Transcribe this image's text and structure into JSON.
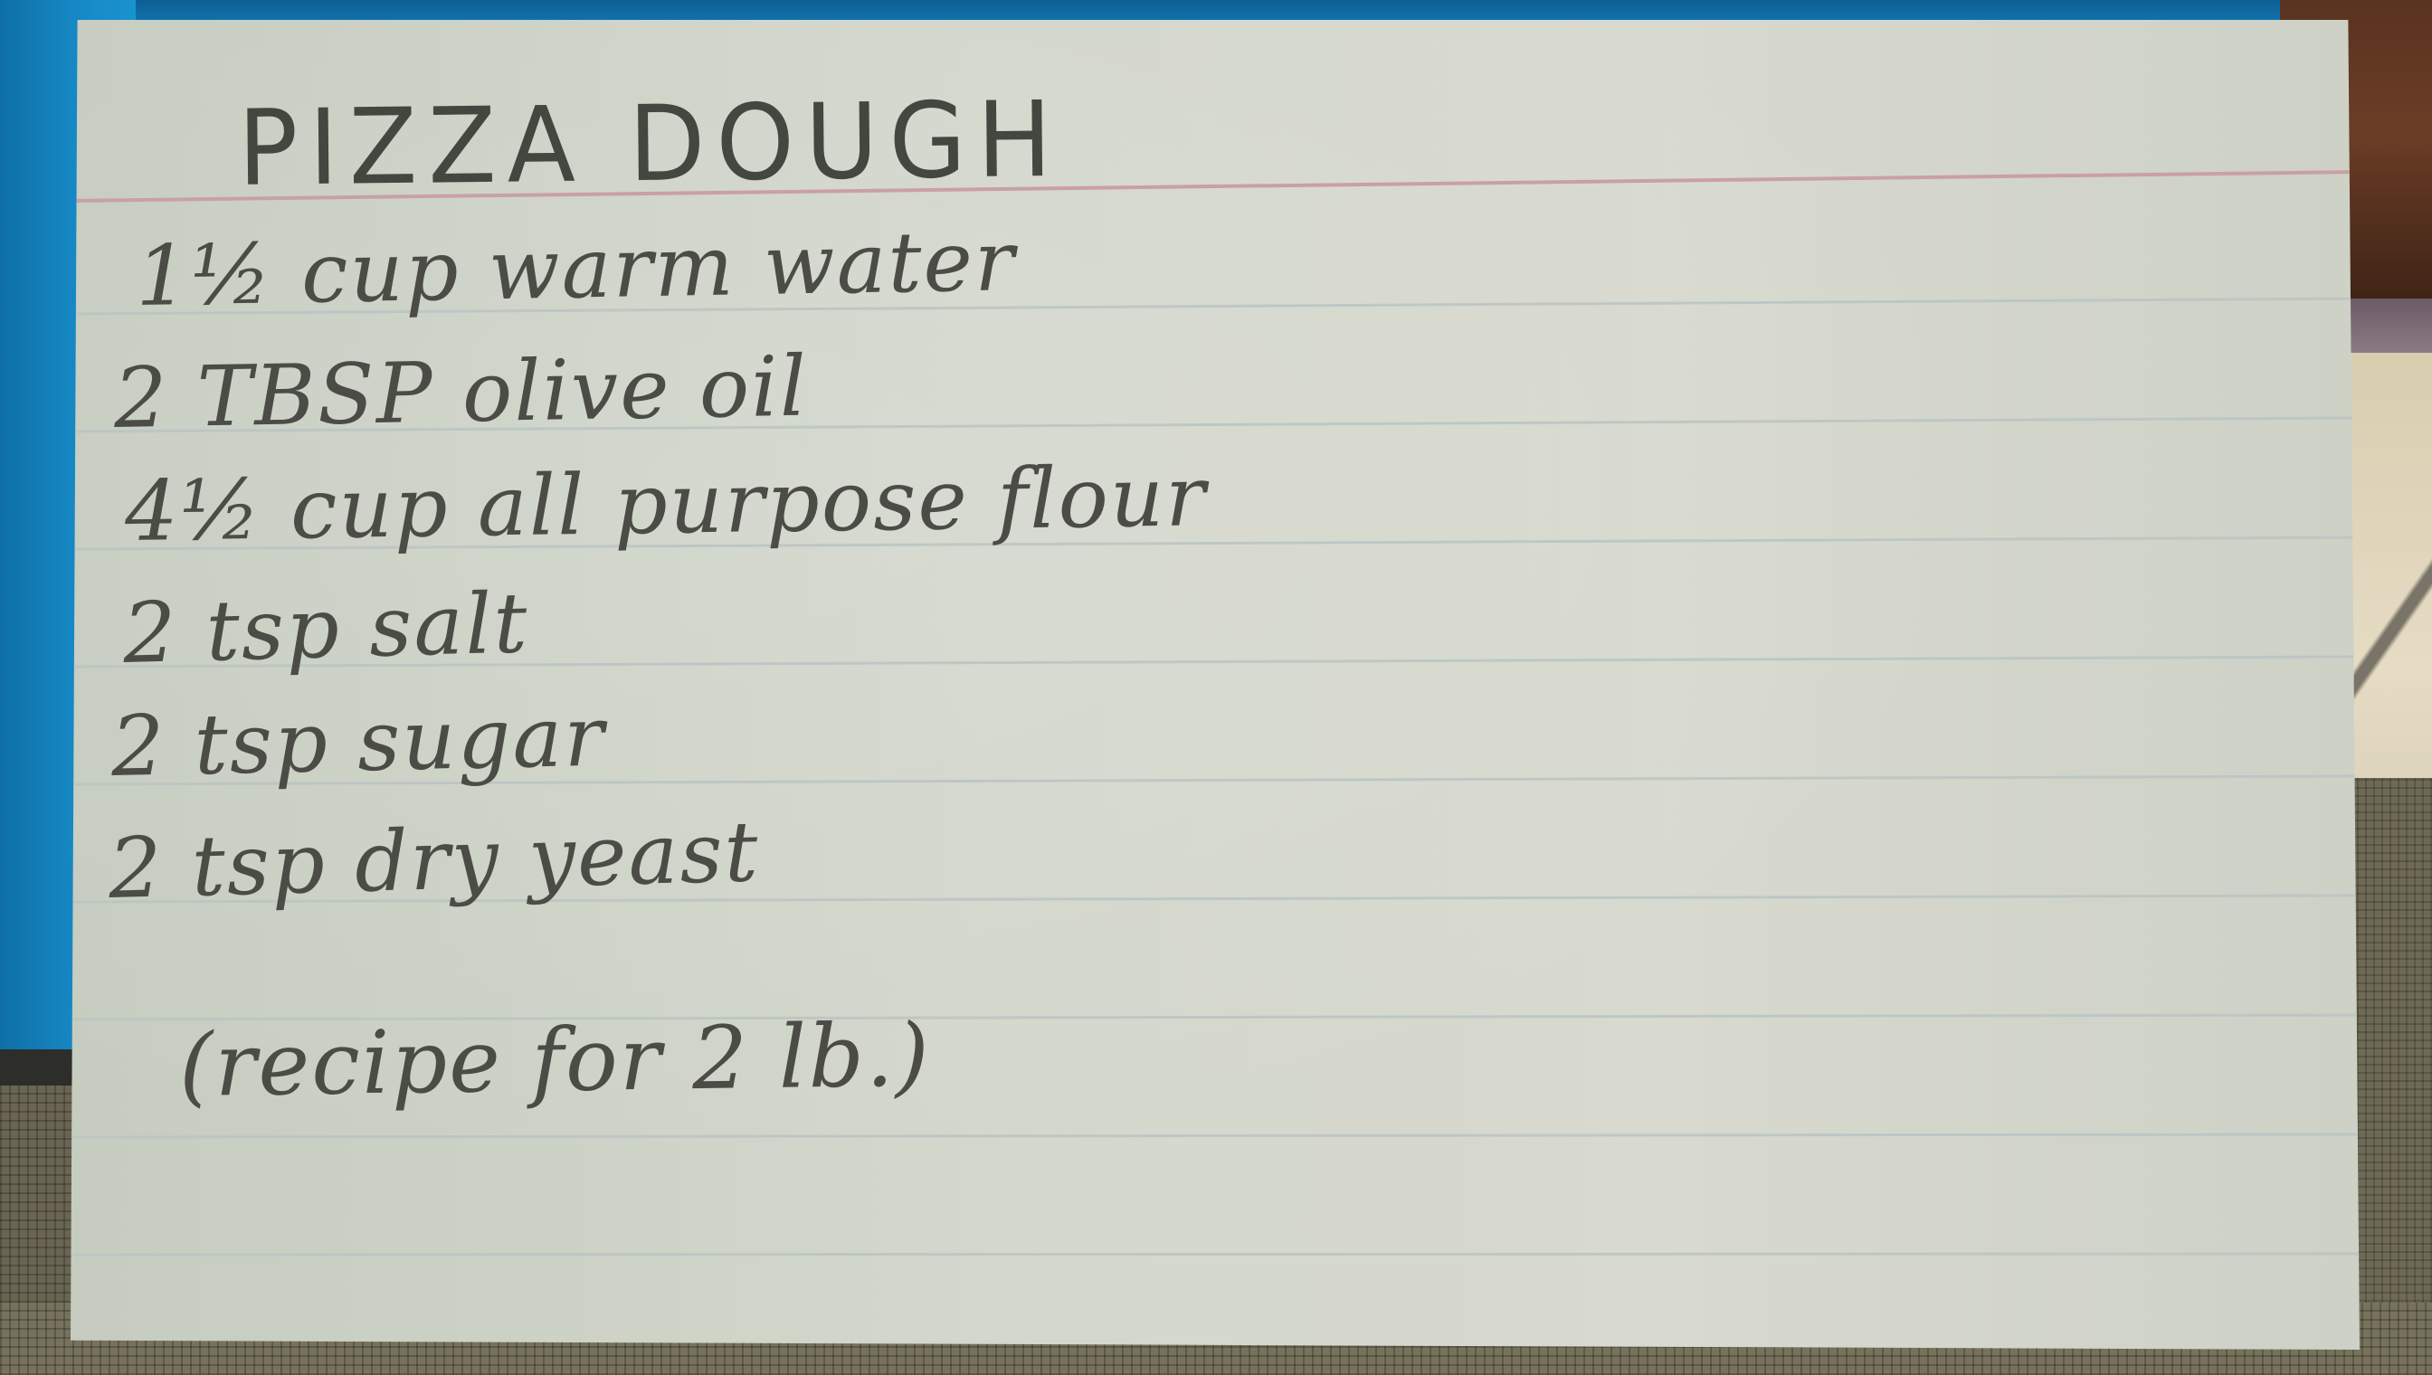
{
  "card": {
    "title": "PIZZA DOUGH",
    "ingredients": [
      "1½ cup warm water",
      "2 TBSP olive oil",
      "4½ cup all purpose flour",
      "2 tsp salt",
      "2 tsp sugar",
      "2 tsp dry yeast"
    ],
    "note": "(recipe for 2 lb.)"
  },
  "colors": {
    "card": "#d3d7cc",
    "ruled_line": "#b9c5c4",
    "header_line": "#c9a0a4",
    "pencil": "#4a4c45"
  }
}
